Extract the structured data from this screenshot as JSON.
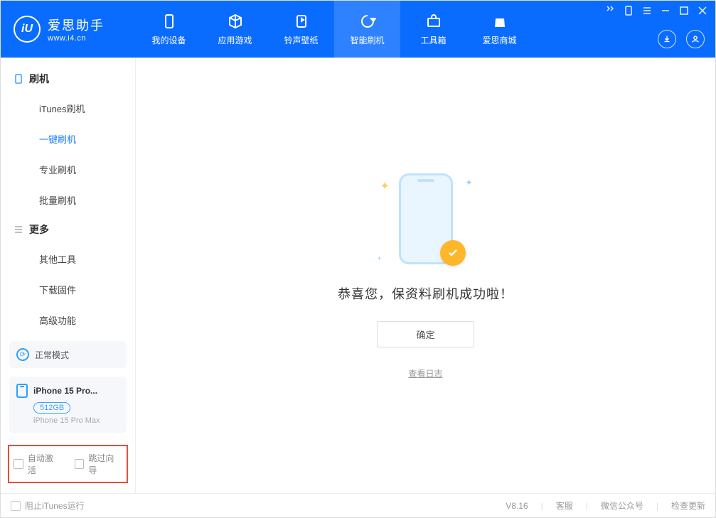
{
  "app": {
    "title": "爱思助手",
    "subtitle": "www.i4.cn"
  },
  "nav": {
    "device": "我的设备",
    "apps": "应用游戏",
    "ringtone": "铃声壁纸",
    "flash": "智能刷机",
    "toolbox": "工具箱",
    "mall": "爱思商城"
  },
  "sidebar": {
    "group1": {
      "title": "刷机",
      "items": [
        "iTunes刷机",
        "一键刷机",
        "专业刷机",
        "批量刷机"
      ]
    },
    "group2": {
      "title": "更多",
      "items": [
        "其他工具",
        "下载固件",
        "高级功能"
      ]
    }
  },
  "status": {
    "mode": "正常模式"
  },
  "device": {
    "name": "iPhone 15 Pro...",
    "storage": "512GB",
    "model": "iPhone 15 Pro Max"
  },
  "checks": {
    "auto_activate": "自动激活",
    "skip_wizard": "跳过向导"
  },
  "main": {
    "message": "恭喜您，保资料刷机成功啦！",
    "confirm": "确定",
    "view_log": "查看日志"
  },
  "footer": {
    "block_itunes": "阻止iTunes运行",
    "version": "V8.16",
    "support": "客服",
    "wechat": "微信公众号",
    "update": "检查更新"
  }
}
